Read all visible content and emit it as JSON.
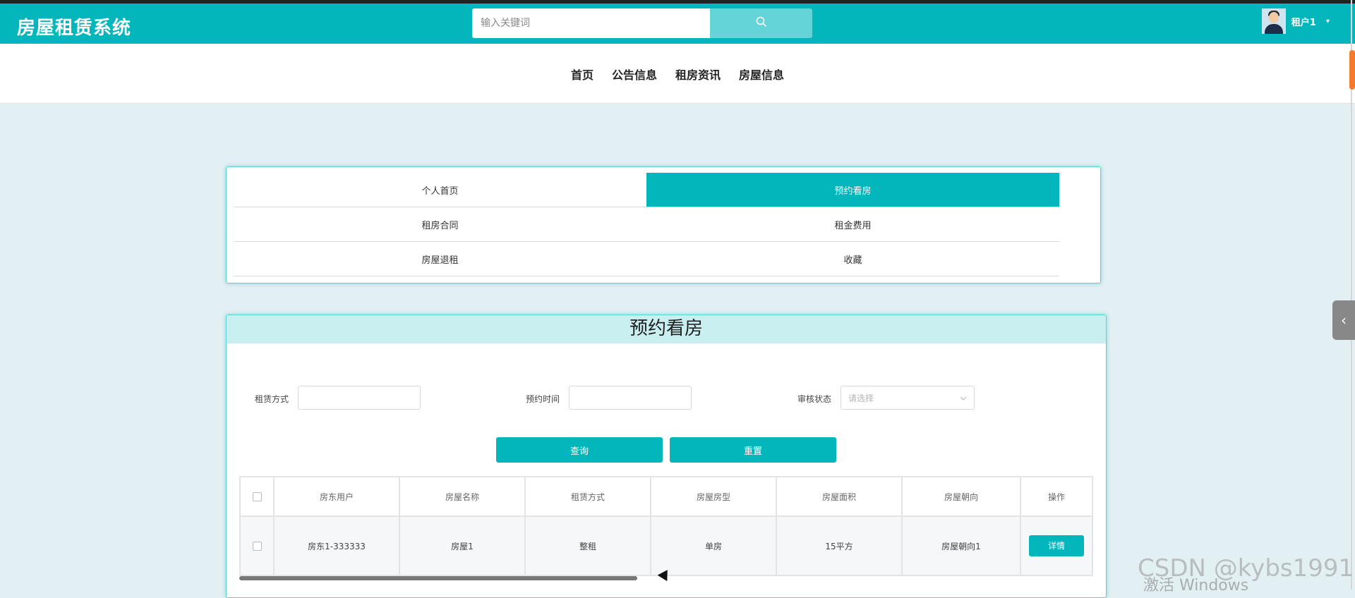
{
  "header": {
    "logo": "房屋租赁系统",
    "search_placeholder": "输入关键词",
    "user_name": "租户1"
  },
  "nav": {
    "items": [
      "首页",
      "公告信息",
      "租房资讯",
      "房屋信息"
    ]
  },
  "menu": {
    "items": [
      "个人首页",
      "预约看房",
      "租房合同",
      "租金费用",
      "房屋退租",
      "收藏"
    ],
    "active": "预约看房"
  },
  "main": {
    "title": "预约看房",
    "filters": {
      "lease_label": "租赁方式",
      "time_label": "预约时间",
      "status_label": "审核状态",
      "status_placeholder": "请选择"
    },
    "buttons": {
      "query": "查询",
      "reset": "重置"
    },
    "table": {
      "headers": [
        "房东用户",
        "房屋名称",
        "租赁方式",
        "房屋房型",
        "房屋面积",
        "房屋朝向",
        "操作"
      ],
      "rows": [
        {
          "cells": [
            "房东1-333333",
            "房屋1",
            "整租",
            "单房",
            "15平方",
            "房屋朝向1"
          ],
          "action": "详情"
        }
      ]
    }
  },
  "overlay": {
    "watermark": "CSDN @kybs1991",
    "activate": "激活 Windows"
  },
  "colors": {
    "primary": "#02b6bc",
    "page_bg": "#e2eff3",
    "title_bar": "#c9eff0"
  }
}
